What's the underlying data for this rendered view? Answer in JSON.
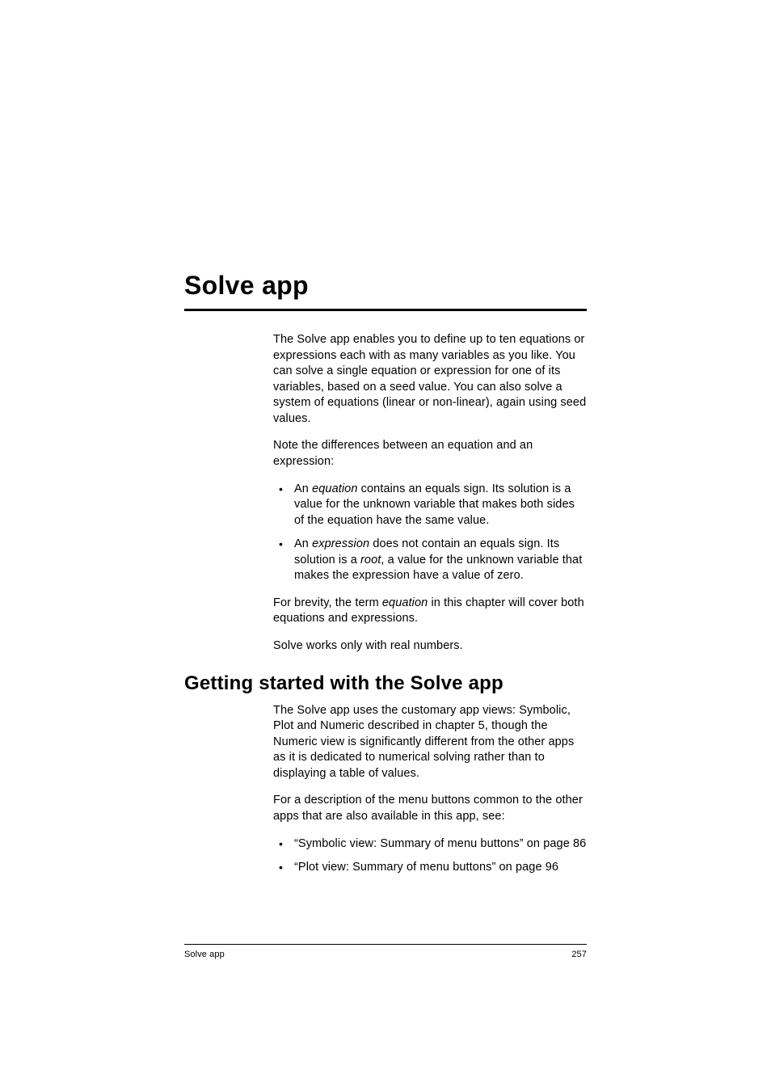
{
  "title": "Solve app",
  "intro": {
    "p1": "The Solve app enables you to define up to ten equations or expressions each with as many variables as you like. You can solve a single equation or expression for one of its variables, based on a seed value. You can also solve a system of equations (linear or non-linear), again using seed values.",
    "p2": "Note the differences between an equation and an expression:",
    "bullets": {
      "b1_pre": "An ",
      "b1_em": "equation",
      "b1_post": " contains an equals sign. Its solution is a value for the unknown variable that makes both sides of the equation have the same value.",
      "b2_pre": "An ",
      "b2_em": "expression",
      "b2_mid": " does not contain an equals sign. Its solution is a ",
      "b2_em2": "root",
      "b2_post": ", a value for the unknown variable that makes the expression have a value of zero."
    },
    "p3_pre": "For brevity, the term ",
    "p3_em": "equation",
    "p3_post": " in this chapter will cover both equations and expressions.",
    "p4": "Solve works only with real numbers."
  },
  "section2": {
    "heading": "Getting started with the Solve app",
    "p1": "The Solve app uses the customary app views: Symbolic, Plot and Numeric described in chapter 5, though the Numeric view is significantly different from the other apps as it is dedicated to numerical solving rather than to displaying a table of values.",
    "p2": "For a description of the menu buttons common to the other apps that are also available in this app, see:",
    "bullets": {
      "b1": "“Symbolic view: Summary of menu buttons” on page 86",
      "b2": "“Plot view: Summary of menu buttons” on page 96"
    }
  },
  "footer": {
    "left": "Solve app",
    "right": "257"
  }
}
